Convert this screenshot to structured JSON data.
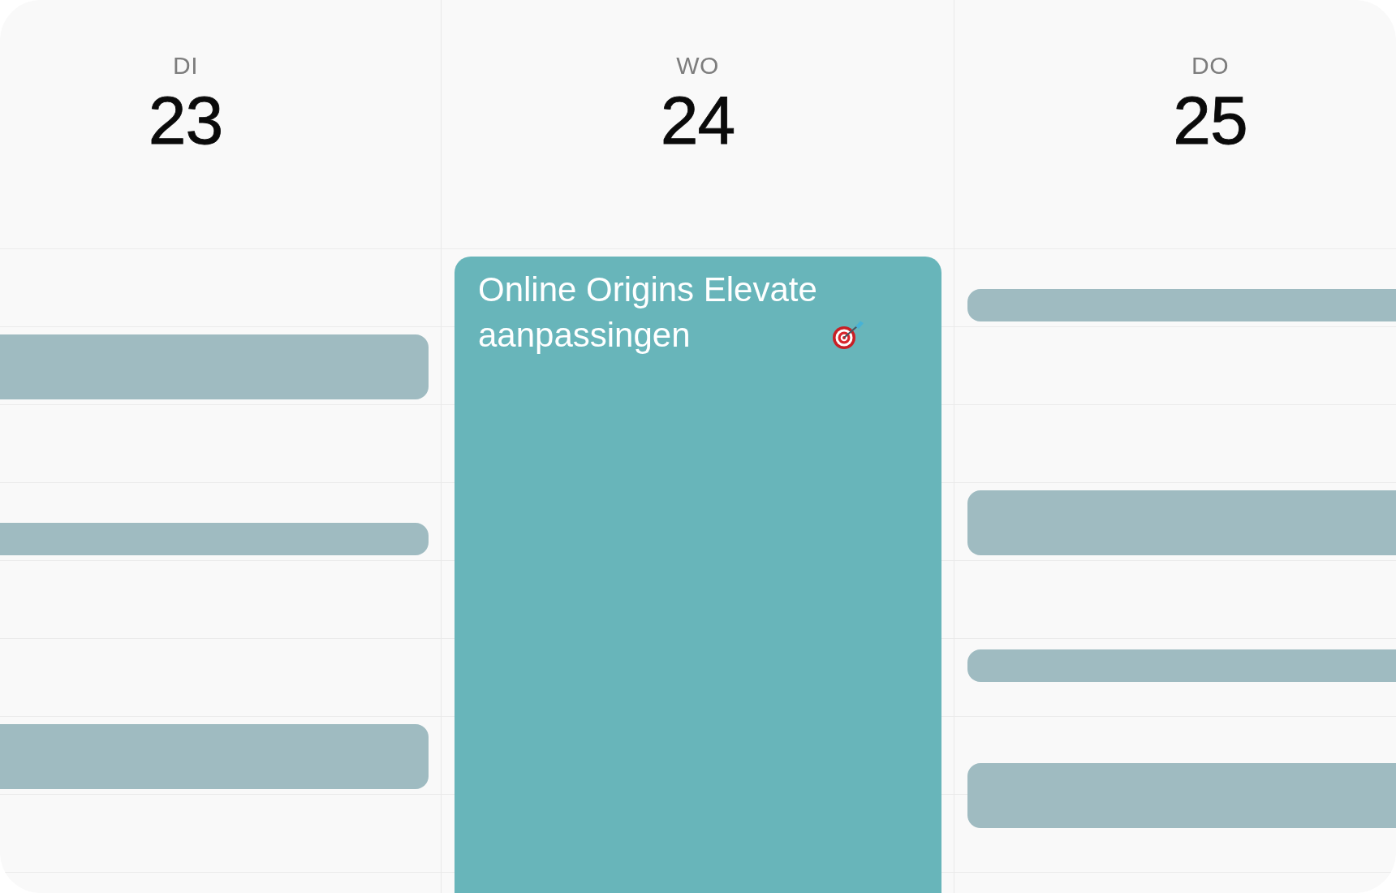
{
  "days": [
    {
      "weekday": "DI",
      "date": "23",
      "events": [
        {
          "color": "#9fbbc1"
        },
        {
          "color": "#9fbbc1"
        },
        {
          "color": "#9fbbc1"
        }
      ]
    },
    {
      "weekday": "WO",
      "date": "24",
      "events": [
        {
          "title": "Online Origins Elevate aanpassingen",
          "color": "#68b5ba"
        }
      ]
    },
    {
      "weekday": "DO",
      "date": "25",
      "events": [
        {
          "color": "#9fbbc1"
        },
        {
          "color": "#9fbbc1"
        },
        {
          "color": "#9fbbc1"
        },
        {
          "color": "#9fbbc1"
        }
      ]
    }
  ]
}
